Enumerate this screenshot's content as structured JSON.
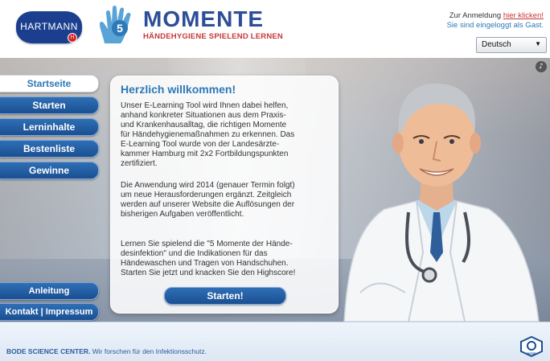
{
  "header": {
    "hartmann_logo": "HARTMANN",
    "hartmann_mark": "H",
    "logo_number": "5",
    "title": "MOMENTE",
    "subtitle": "HÄNDEHYGIENE SPIELEND LERNEN",
    "login_prefix": "Zur Anmeldung ",
    "login_link": "hier klicken!",
    "login_status": "Sie sind eingeloggt als Gast.",
    "language": "Deutsch"
  },
  "nav": {
    "items": [
      {
        "label": "Startseite",
        "active": true
      },
      {
        "label": "Starten"
      },
      {
        "label": "Lerninhalte"
      },
      {
        "label": "Bestenliste"
      },
      {
        "label": "Gewinne"
      }
    ],
    "bottom": [
      {
        "label": "Anleitung"
      },
      {
        "label": "Kontakt | Impressum"
      }
    ]
  },
  "welcome": {
    "title": "Herzlich willkommen!",
    "p1": "Unser E-Learning Tool wird Ihnen dabei helfen,\nanhand konkreter Situationen aus dem Praxis-\nund Krankenhausalltag, die richtigen Momente\nfür Händehygienemaßnahmen zu erkennen. Das\nE-Learning Tool wurde von der Landesärzte-\nkammer Hamburg mit 2x2 Fortbildungspunkten\nzertifiziert.",
    "p2": "Die Anwendung wird 2014 (genauer Termin folgt)\num neue Herausforderungen ergänzt. Zeitgleich\nwerden auf unserer Website die Auflösungen der\nbisherigen Aufgaben veröffentlicht.",
    "p3": "Lernen Sie spielend die \"5 Momente der Hände-\ndesinfektion\" und die Indikationen für das\nHändewaschen und Tragen von Handschuhen.\nStarten Sie jetzt und knacken Sie den Highscore!",
    "start_button": "Starten!"
  },
  "footer": {
    "company": "BODE SCIENCE CENTER.",
    "tagline": " Wir forschen für den Infektionsschutz.",
    "badge": "BODE"
  },
  "colors": {
    "brand_blue": "#2d79b7",
    "nav_blue": "#1b4f92",
    "accent_red": "#c7373a"
  },
  "icons": {
    "music": "music-note-icon",
    "select_arrow": "dropdown-arrow-icon"
  }
}
